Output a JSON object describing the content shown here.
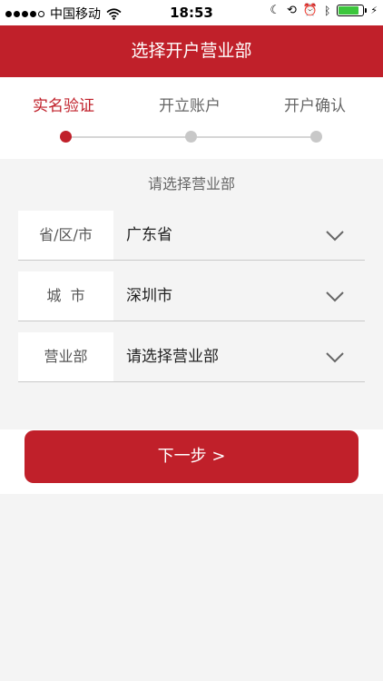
{
  "status": {
    "carrier": "中国移动",
    "time": "18:53"
  },
  "nav": {
    "title": "选择开户营业部"
  },
  "steps": [
    {
      "label": "实名验证",
      "active": true
    },
    {
      "label": "开立账户",
      "active": false
    },
    {
      "label": "开户确认",
      "active": false
    }
  ],
  "prompt": "请选择营业部",
  "fields": [
    {
      "label": "省/区/市",
      "value": "广东省"
    },
    {
      "label": "城  市",
      "value": "深圳市"
    },
    {
      "label": "营业部",
      "value": "请选择营业部"
    }
  ],
  "next_button": "下一步 >",
  "colors": {
    "brand": "#c0202a",
    "battery": "#3cc63c"
  }
}
